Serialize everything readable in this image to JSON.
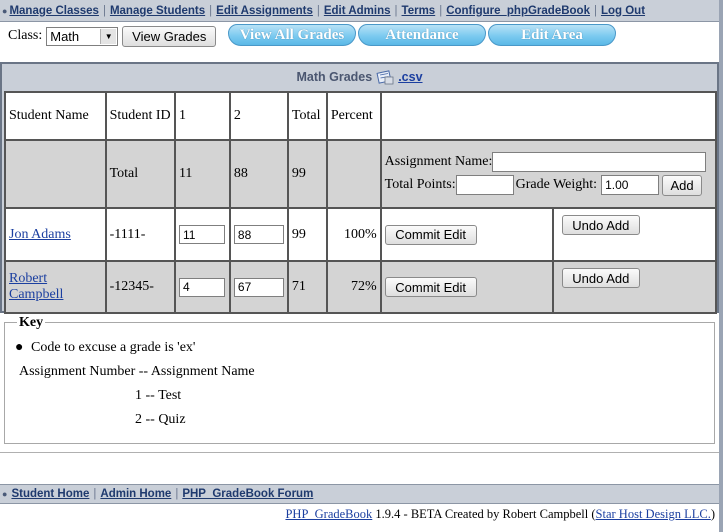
{
  "nav": {
    "items": [
      "Manage Classes",
      "Manage Students",
      "Edit Assignments",
      "Edit Admins",
      "Terms",
      "Configure_phpGradeBook",
      "Log Out"
    ]
  },
  "class_selector": {
    "label": "Class:",
    "selected": "Math",
    "view_button": "View Grades"
  },
  "tabs": [
    "View All Grades",
    "Attendance",
    "Edit Area"
  ],
  "grades": {
    "title": "Math Grades",
    "csv_link": ".csv",
    "headers": [
      "Student Name",
      "Student ID",
      "1",
      "2",
      "Total",
      "Percent"
    ],
    "total_row": {
      "label": "Total",
      "a1": "11",
      "a2": "88",
      "total": "99"
    },
    "add_assignment": {
      "name_label": "Assignment Name:",
      "points_label": "Total Points:",
      "weight_label": "Grade Weight:",
      "weight_value": "1.00",
      "add_button": "Add"
    },
    "students": [
      {
        "name": "Jon Adams",
        "id": "-1111-",
        "a1": "11",
        "a2": "88",
        "total": "99",
        "percent": "100%",
        "commit": "Commit Edit",
        "undo": "Undo Add"
      },
      {
        "name": "Robert Campbell",
        "id": "-12345-",
        "a1": "4",
        "a2": "67",
        "total": "71",
        "percent": "72%",
        "commit": "Commit Edit",
        "undo": "Undo Add"
      }
    ]
  },
  "key": {
    "legend": "Key",
    "bullet": "Code to excuse a grade is 'ex'",
    "heading": "Assignment Number -- Assignment Name",
    "assignments": [
      "1 -- Test",
      "2 -- Quiz"
    ]
  },
  "bottom_nav": {
    "items": [
      "Student Home",
      "Admin Home",
      "PHP_GradeBook Forum"
    ]
  },
  "footer": {
    "product_link": "PHP_GradeBook",
    "text": " 1.9.4 - BETA Created by Robert Campbell (",
    "company_link": "Star Host Design LLC.",
    "close": ")"
  },
  "colors": {
    "nav_bg": "#c9cfd8",
    "tab_blue": "#7ccaf0",
    "link_blue": "#1b3fa0"
  }
}
